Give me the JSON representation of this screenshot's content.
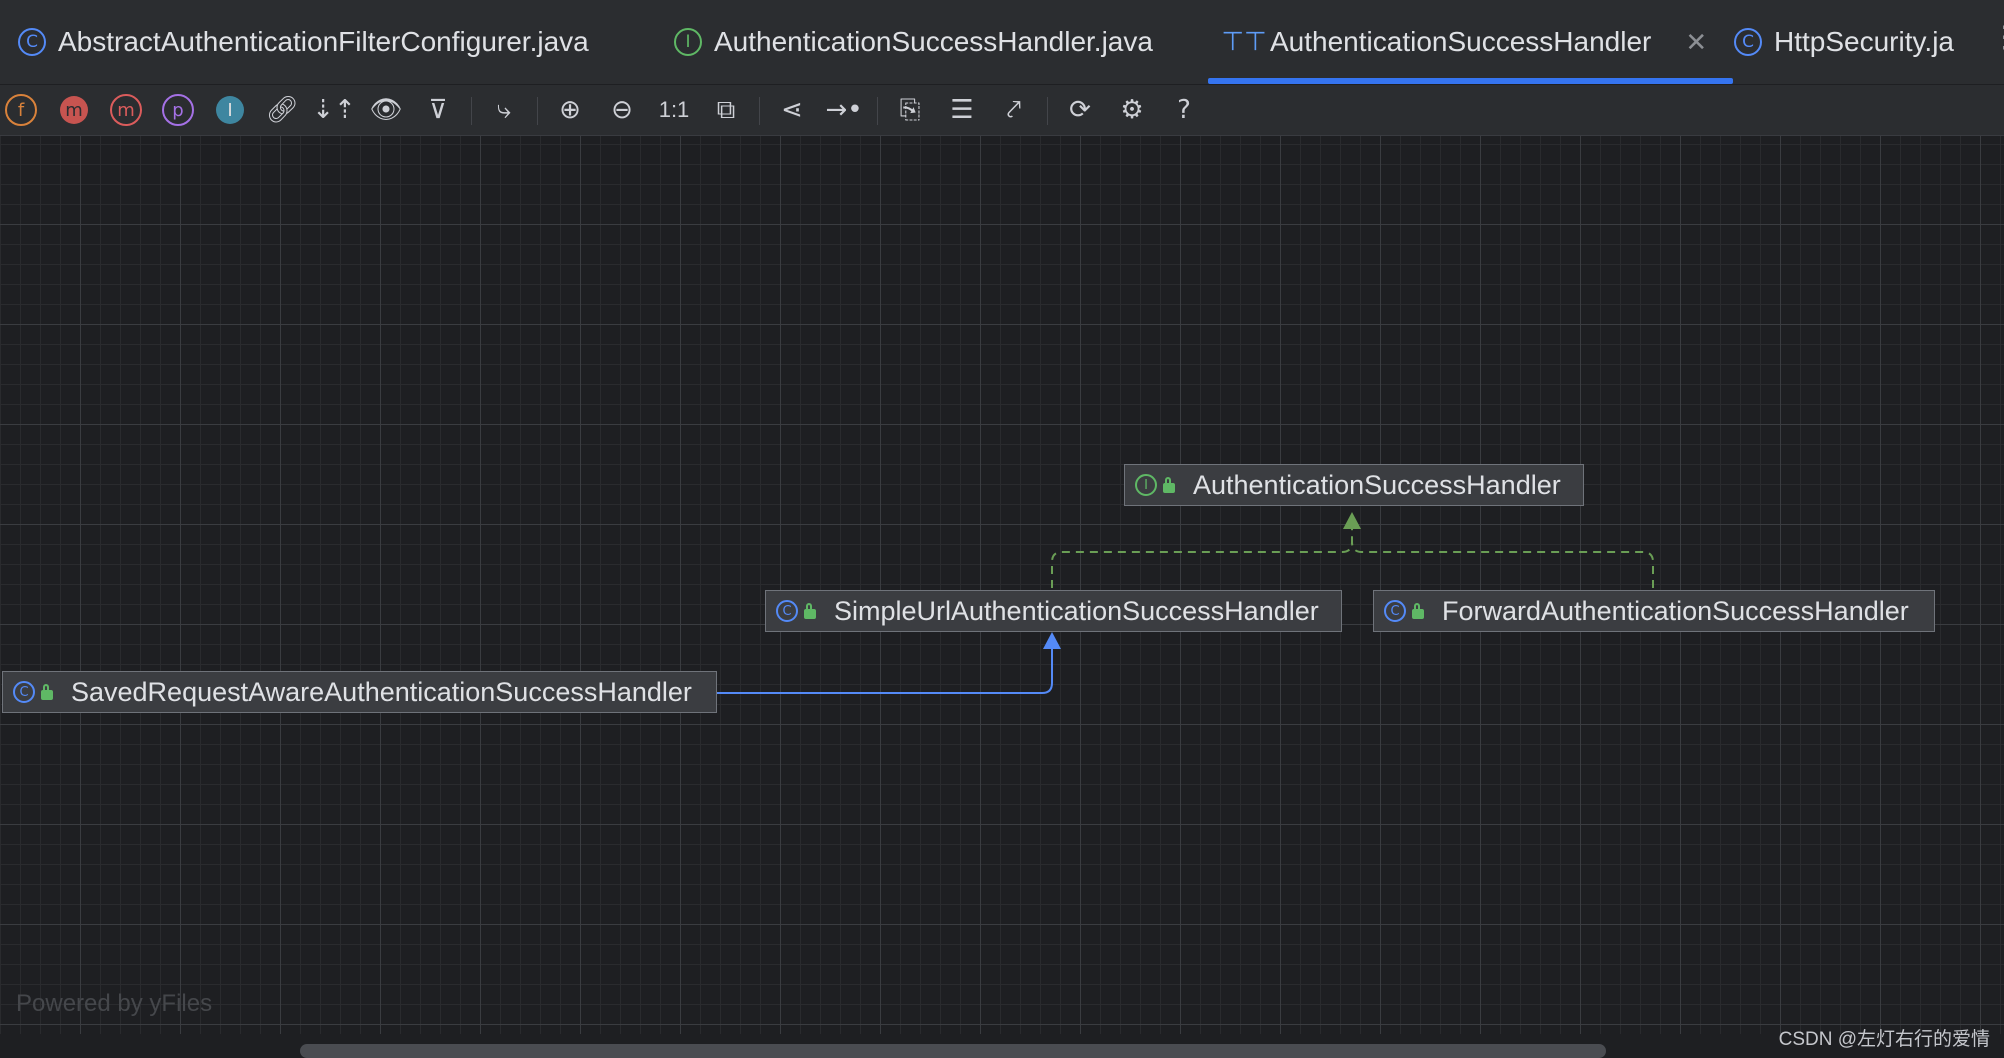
{
  "tabs": [
    {
      "label": "AbstractAuthenticationFilterConfigurer.java",
      "icon": "class-icon"
    },
    {
      "label": "AuthenticationSuccessHandler.java",
      "icon": "interface-icon"
    },
    {
      "label": "AuthenticationSuccessHandler",
      "icon": "hierarchy-diagram-icon",
      "active": true
    },
    {
      "label": "HttpSecurity.ja",
      "icon": "class-icon"
    }
  ],
  "toolbar": {
    "field_glyph": "f",
    "member_glyph": "m",
    "method_glyph": "m",
    "property_glyph": "p",
    "interface_glyph": "I",
    "actual_size_label": "1:1",
    "help_glyph": "?"
  },
  "diagram": {
    "nodes": [
      {
        "id": "ash",
        "label": "AuthenticationSuccessHandler",
        "kind": "interface"
      },
      {
        "id": "simple",
        "label": "SimpleUrlAuthenticationSuccessHandler",
        "kind": "class"
      },
      {
        "id": "forward",
        "label": "ForwardAuthenticationSuccessHandler",
        "kind": "class"
      },
      {
        "id": "saved",
        "label": "SavedRequestAwareAuthenticationSuccessHandler",
        "kind": "class"
      }
    ],
    "edges": [
      {
        "from": "simple",
        "to": "ash",
        "type": "implements"
      },
      {
        "from": "forward",
        "to": "ash",
        "type": "implements"
      },
      {
        "from": "saved",
        "to": "simple",
        "type": "extends"
      }
    ]
  },
  "class_glyph": "C",
  "interface_glyph": "I",
  "powered_by": "Powered by yFiles",
  "watermark": "CSDN @左灯右行的爱情",
  "colors": {
    "accent": "#3574f0",
    "class_icon": "#548af7",
    "interface_icon": "#5fb865",
    "implements_edge": "#6a9e55",
    "extends_edge": "#548af7",
    "node_bg": "#3b3d41"
  }
}
